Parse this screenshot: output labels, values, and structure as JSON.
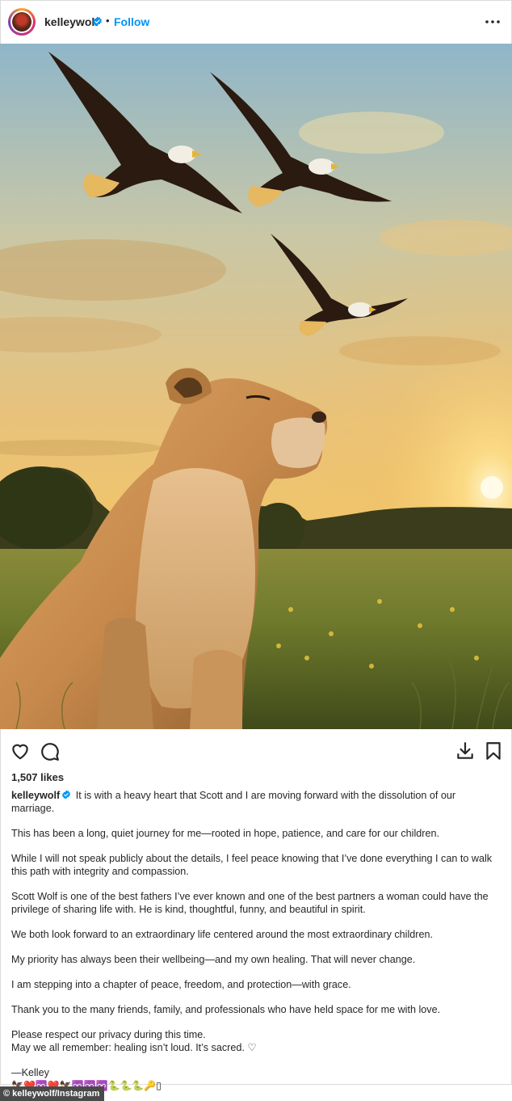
{
  "header": {
    "username": "kelleywolf",
    "separator": "•",
    "follow_label": "Follow"
  },
  "post": {
    "likes": "1,507 likes",
    "caption": {
      "username": "kelleywolf",
      "lines": [
        "It is with a heavy heart that Scott and I are moving forward with the dissolution of our marriage.",
        "This has been a long, quiet journey for me—rooted in hope, patience, and care for our children.",
        "While I will not speak publicly about the details, I feel peace knowing that I’ve done everything I can to walk this path with integrity and compassion.",
        "Scott Wolf is one of the best fathers I’ve ever known and one of the best partners a woman could have the privilege of sharing life with. He is kind, thoughtful, funny, and beautiful in spirit.",
        "We both look forward to an extraordinary life centered around the most extraordinary children.",
        "My priority has always been their wellbeing—and my own healing. That will never change.",
        "I am stepping into a chapter of peace, freedom, and protection—with grace.",
        "Thank you to the many friends, family, and professionals who have held space for me with love."
      ],
      "closing_line_1": "Please respect our privacy during this time.",
      "closing_line_2": "May we all remember: healing isn’t loud. It’s sacred.",
      "closing_heart": "♡",
      "signature": "—Kelley",
      "emoji_line": "🦅❤️♾️❤️🦅♾️♾️♾️🐍🐍🐍🔑▯"
    }
  },
  "credit": "© kelleywolf/Instagram",
  "icons": {
    "like": "heart-icon",
    "comment": "comment-icon",
    "download": "download-icon",
    "save": "bookmark-icon",
    "more": "more-options-icon",
    "verified": "verified-badge-icon"
  },
  "colors": {
    "link": "#0095f6",
    "verified": "#0095f6",
    "text": "#262626"
  }
}
